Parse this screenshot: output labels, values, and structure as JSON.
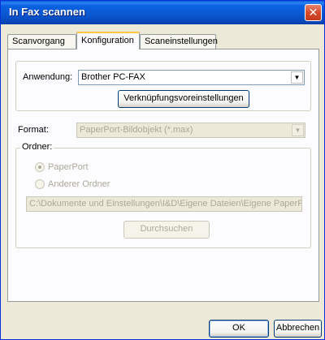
{
  "window": {
    "title": "In Fax scannen"
  },
  "tabs": [
    {
      "label": "Scanvorgang"
    },
    {
      "label": "Konfiguration"
    },
    {
      "label": "Scaneinstellungen"
    }
  ],
  "application": {
    "label": "Anwendung:",
    "value": "Brother PC-FAX",
    "link_defaults_button": "Verknüpfungsvoreinstellungen"
  },
  "format": {
    "label": "Format:",
    "value": "PaperPort-Bildobjekt (*.max)"
  },
  "folder": {
    "label": "Ordner:",
    "options": [
      {
        "label": "PaperPort",
        "checked": true
      },
      {
        "label": "Anderer Ordner",
        "checked": false
      }
    ],
    "path": "C:\\Dokumente und Einstellungen\\I&D\\Eigene Dateien\\Eigene PaperPor",
    "browse_button": "Durchsuchen"
  },
  "footer": {
    "ok_label": "OK",
    "cancel_label": "Abbrechen"
  },
  "colors": {
    "titlebar": "#0a56d0",
    "close_button": "#d8492b",
    "active_tab_highlight": "#ffc83c"
  },
  "icons": {
    "close": "close-icon",
    "dropdown": "chevron-down-icon"
  }
}
